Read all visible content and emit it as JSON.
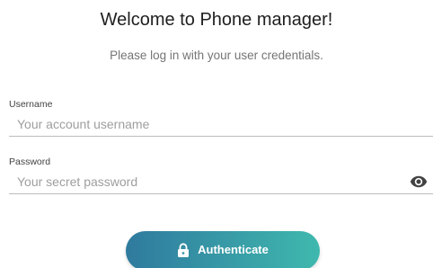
{
  "header": {
    "title": "Welcome to Phone manager!",
    "subtitle": "Please log in with your user credentials."
  },
  "form": {
    "username": {
      "label": "Username",
      "placeholder": "Your account username",
      "value": ""
    },
    "password": {
      "label": "Password",
      "placeholder": "Your secret password",
      "value": "",
      "toggle_icon": "eye-icon"
    },
    "submit": {
      "label": "Authenticate",
      "icon": "lock-icon"
    }
  },
  "colors": {
    "button_gradient_start": "#2f7a9e",
    "button_gradient_end": "#3fb8ae",
    "underline": "#bdbdbd",
    "placeholder": "#9e9e9e",
    "subtitle": "#757575"
  }
}
